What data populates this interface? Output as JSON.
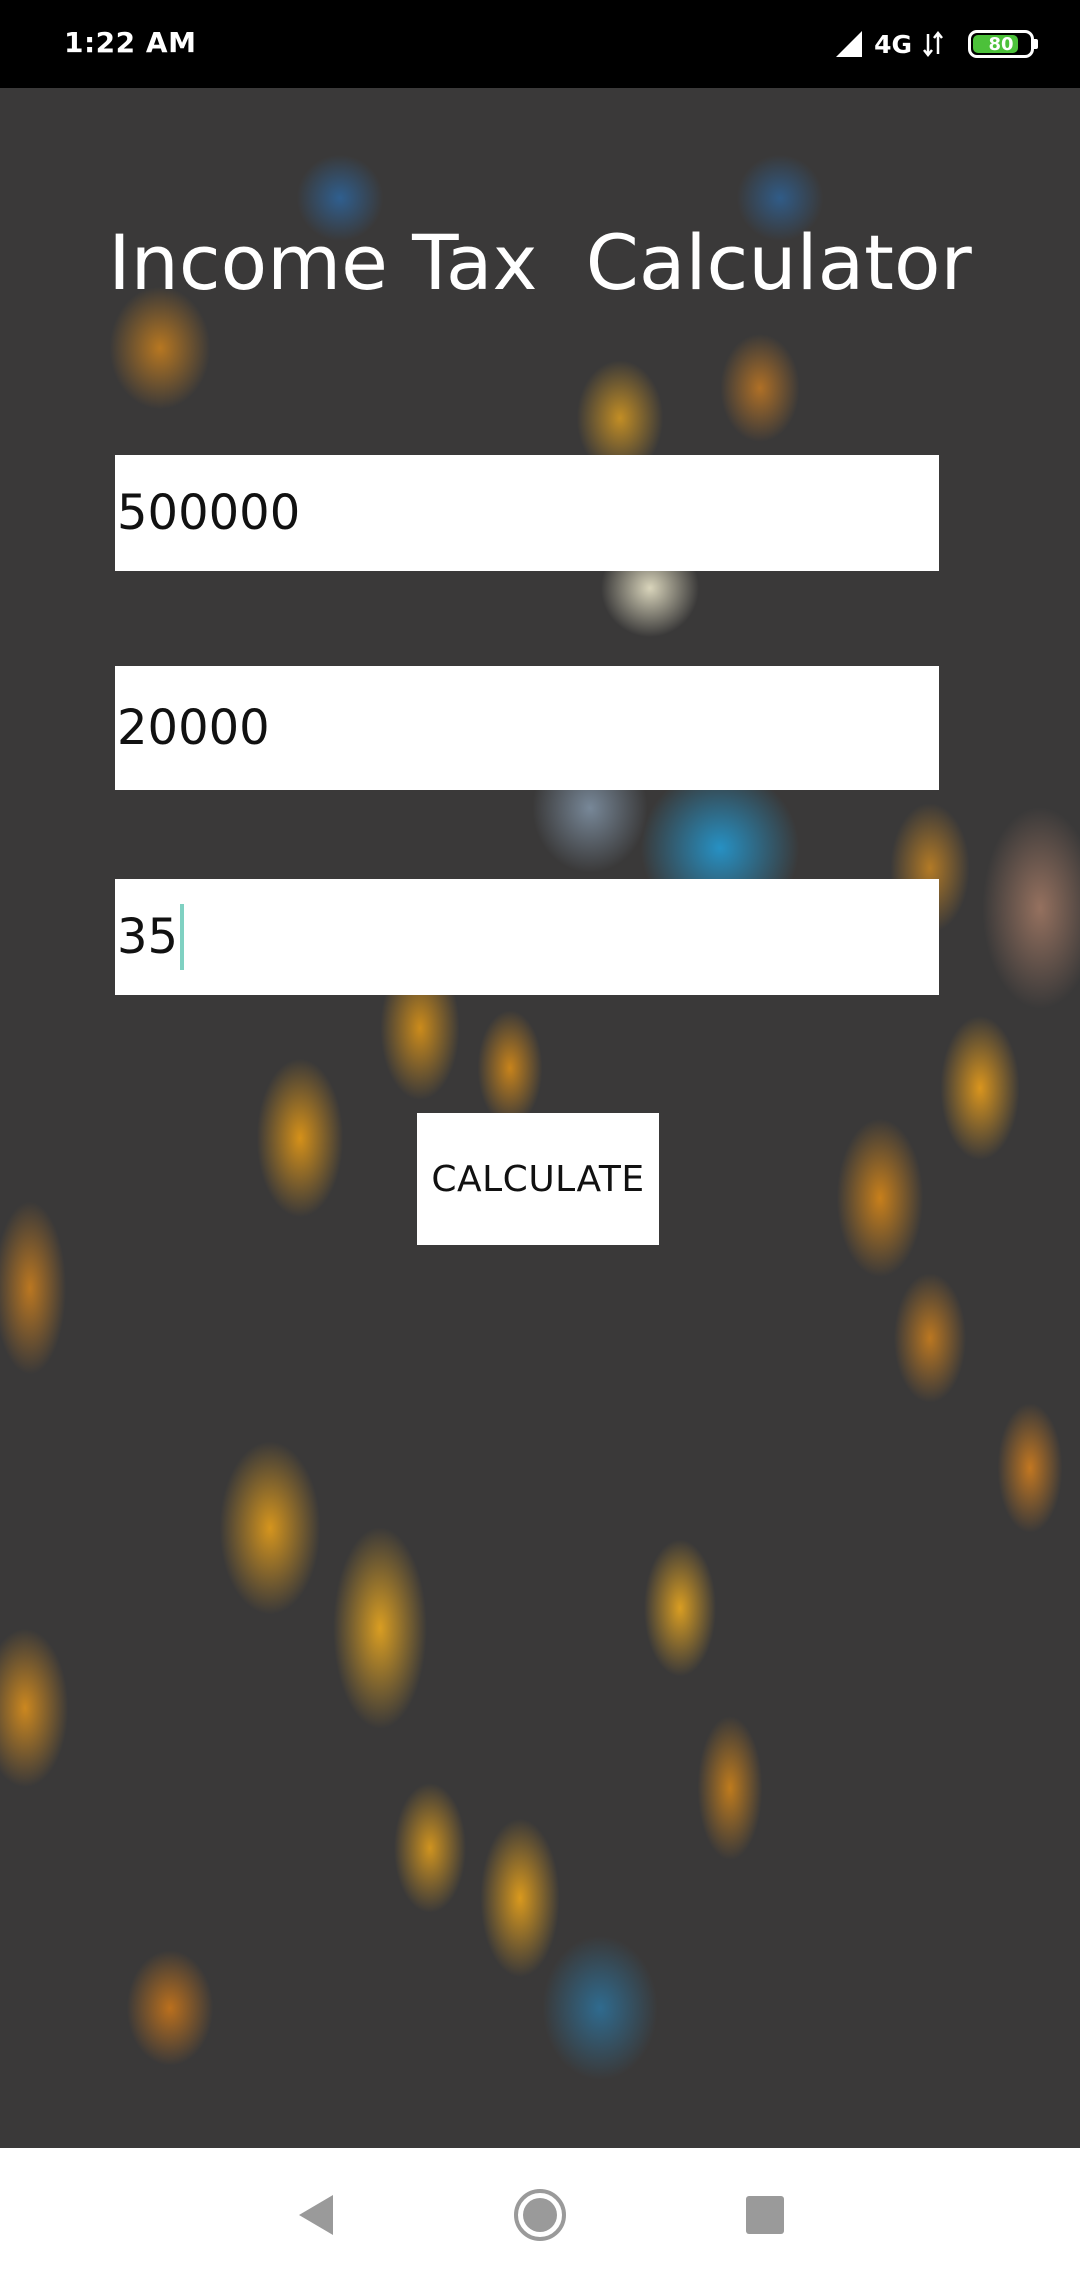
{
  "status_bar": {
    "time": "1:22 AM",
    "network": "4G",
    "battery_level": "80",
    "battery_fraction": 0.8,
    "battery_color": "#4cc13a"
  },
  "app": {
    "title": "Income Tax  Calculator",
    "fields": [
      {
        "value": "500000"
      },
      {
        "value": "20000"
      },
      {
        "value": "35"
      }
    ],
    "calculate_label": "CALCULATE"
  },
  "nav_bar": {
    "icons": [
      "back-icon",
      "home-icon",
      "recent-apps-icon"
    ]
  },
  "colors": {
    "background": "#3a3939",
    "caret": "#7fd1c2",
    "field_background": "#ffffff"
  }
}
